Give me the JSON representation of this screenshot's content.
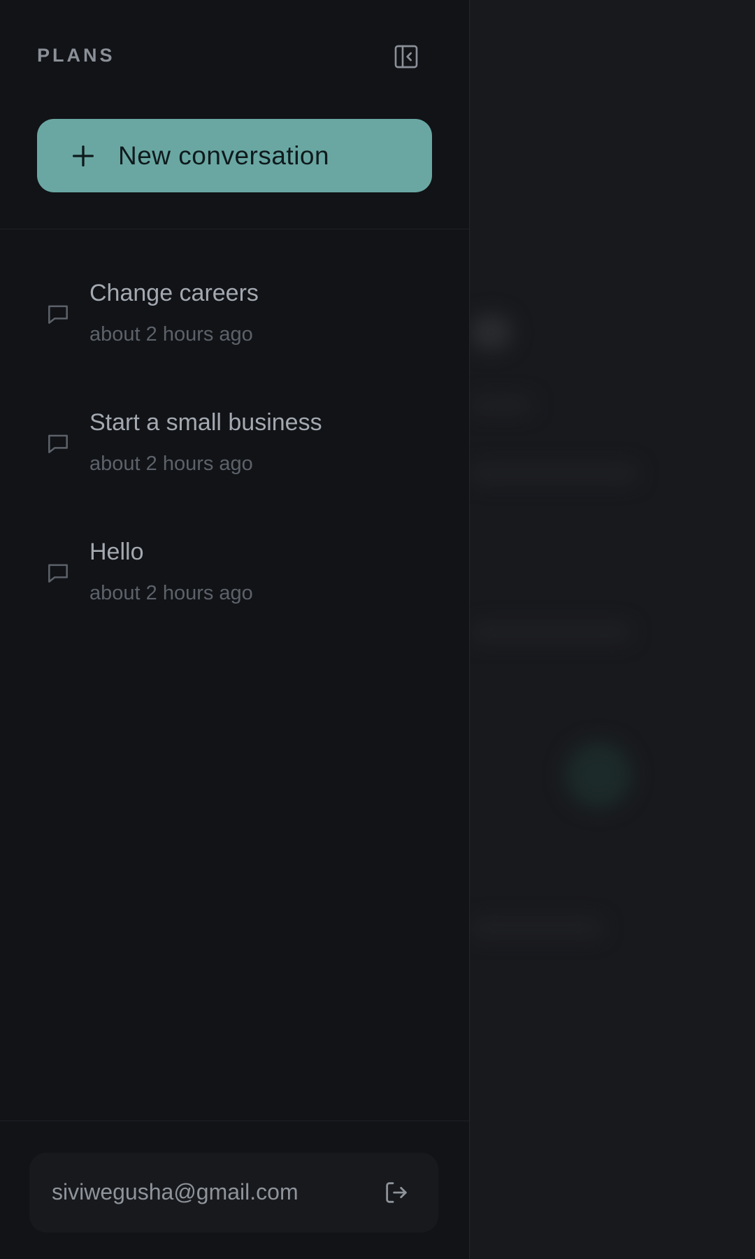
{
  "sidebar": {
    "title": "PLANS",
    "collapse_icon": "sidebar-collapse-icon",
    "new_conversation": {
      "label": "New conversation",
      "icon": "plus-icon",
      "color": "#6aa7a3"
    },
    "conversations": [
      {
        "title": "Change careers",
        "time": "about 2 hours ago",
        "icon": "chat-bubble-icon"
      },
      {
        "title": "Start a small business",
        "time": "about 2 hours ago",
        "icon": "chat-bubble-icon"
      },
      {
        "title": "Hello",
        "time": "about 2 hours ago",
        "icon": "chat-bubble-icon"
      }
    ],
    "account": {
      "email": "siviwegusha@gmail.com",
      "logout_icon": "logout-icon"
    }
  },
  "colors": {
    "sidebar_bg": "#111317",
    "backdrop_bg": "#18191d",
    "accent": "#6aa7a3"
  }
}
